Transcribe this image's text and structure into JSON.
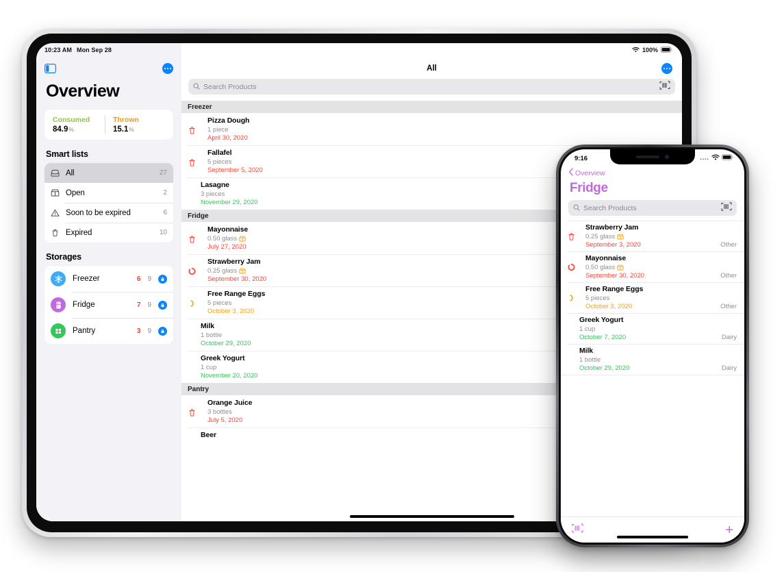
{
  "ipad": {
    "status_bar": {
      "time": "10:23 AM",
      "date": "Mon Sep 28",
      "battery_percent": "100%",
      "wifi_icon": "wifi-icon",
      "battery_icon": "battery-icon"
    },
    "sidebar": {
      "toggle_icon": "sidebar-toggle-icon",
      "more_icon": "more-ellipsis-icon",
      "title": "Overview",
      "stats": [
        {
          "label": "Consumed",
          "value": "84.9",
          "unit": "%",
          "color": "#8bc53f"
        },
        {
          "label": "Thrown",
          "value": "15.1",
          "unit": "%",
          "color": "#ff9500"
        }
      ],
      "smart_lists_header": "Smart lists",
      "smart_lists": [
        {
          "label": "All",
          "count": "27",
          "icon": "tray-icon",
          "selected": true
        },
        {
          "label": "Open",
          "count": "2",
          "icon": "open-box-icon",
          "selected": false
        },
        {
          "label": "Soon to be expired",
          "count": "6",
          "icon": "warning-triangle-icon",
          "selected": false
        },
        {
          "label": "Expired",
          "count": "10",
          "icon": "trash-icon",
          "selected": false
        }
      ],
      "storages_header": "Storages",
      "storages": [
        {
          "label": "Freezer",
          "count_red": "6",
          "count_grey": "9",
          "icon": "snowflake-icon",
          "color": "#3dabf5",
          "badge_icon": "lock-icon"
        },
        {
          "label": "Fridge",
          "count_red": "7",
          "count_grey": "9",
          "icon": "fridge-icon",
          "color": "#c06ae0",
          "badge_icon": "lock-icon"
        },
        {
          "label": "Pantry",
          "count_red": "3",
          "count_grey": "9",
          "icon": "pantry-icon",
          "color": "#34c759",
          "badge_icon": "lock-icon"
        }
      ]
    },
    "detail": {
      "title": "All",
      "more_icon": "more-ellipsis-icon",
      "search": {
        "placeholder": "Search Products",
        "search_icon": "search-icon",
        "barcode_icon": "barcode-scanner-icon"
      },
      "sections": [
        {
          "name": "Freezer",
          "items": [
            {
              "name": "Pizza Dough",
              "amount": "1 piece",
              "date": "April 30, 2020",
              "date_color": "#ff453a",
              "status_icon": "trash-icon",
              "indent": true,
              "opened": false
            },
            {
              "name": "Fallafel",
              "amount": "5 pieces",
              "date": "September 5, 2020",
              "date_color": "#ff453a",
              "status_icon": "trash-icon",
              "indent": true,
              "opened": false
            },
            {
              "name": "Lasagne",
              "amount": "3 pieces",
              "date": "November 29, 2020",
              "date_color": "#34c759",
              "status_icon": "",
              "indent": false,
              "opened": false
            }
          ]
        },
        {
          "name": "Fridge",
          "items": [
            {
              "name": "Mayonnaise",
              "amount": "0.50 glass",
              "date": "July 27, 2020",
              "date_color": "#ff453a",
              "status_icon": "trash-icon",
              "indent": true,
              "opened": true
            },
            {
              "name": "Strawberry Jam",
              "amount": "0.25 glass",
              "date": "September 30, 2020",
              "date_color": "#ff453a",
              "status_icon": "expiring-circle-icon",
              "indent": true,
              "opened": true
            },
            {
              "name": "Free Range Eggs",
              "amount": "5 pieces",
              "date": "October 3, 2020",
              "date_color": "#ff9f0a",
              "status_icon": "soon-crescent-icon",
              "indent": true,
              "opened": false
            },
            {
              "name": "Milk",
              "amount": "1 bottle",
              "date": "October 29, 2020",
              "date_color": "#34c759",
              "status_icon": "",
              "indent": false,
              "opened": false
            },
            {
              "name": "Greek Yogurt",
              "amount": "1 cup",
              "date": "November 20, 2020",
              "date_color": "#34c759",
              "status_icon": "",
              "indent": false,
              "opened": false
            }
          ]
        },
        {
          "name": "Pantry",
          "items": [
            {
              "name": "Orange Juice",
              "amount": "3 bottles",
              "date": "July 5, 2020",
              "date_color": "#ff453a",
              "status_icon": "trash-icon",
              "indent": true,
              "opened": false
            },
            {
              "name": "Beer",
              "amount": "",
              "date": "",
              "date_color": "#34c759",
              "status_icon": "",
              "indent": false,
              "opened": false
            }
          ]
        }
      ]
    }
  },
  "iphone": {
    "status_bar": {
      "time": "9:16",
      "wifi_icon": "wifi-icon",
      "battery_icon": "battery-icon",
      "signal_icon": "signal-dots-icon"
    },
    "back_label": "Overview",
    "back_icon": "chevron-left-icon",
    "title": "Fridge",
    "search": {
      "placeholder": "Search Products",
      "search_icon": "search-icon",
      "barcode_icon": "barcode-scanner-icon"
    },
    "items": [
      {
        "name": "Strawberry Jam",
        "amount": "0.25 glass",
        "date": "September 3, 2020",
        "date_color": "#ff453a",
        "category": "Other",
        "status_icon": "trash-icon",
        "indent": true,
        "opened": true
      },
      {
        "name": "Mayonnaise",
        "amount": "0.50 glass",
        "date": "September 30, 2020",
        "date_color": "#ff453a",
        "category": "Other",
        "status_icon": "expiring-circle-icon",
        "indent": true,
        "opened": true
      },
      {
        "name": "Free Range Eggs",
        "amount": "5 pieces",
        "date": "October 3, 2020",
        "date_color": "#ff9f0a",
        "category": "Other",
        "status_icon": "soon-crescent-icon",
        "indent": true,
        "opened": false
      },
      {
        "name": "Greek Yogurt",
        "amount": "1 cup",
        "date": "October 7, 2020",
        "date_color": "#34c759",
        "category": "Dairy",
        "status_icon": "",
        "indent": false,
        "opened": false
      },
      {
        "name": "Milk",
        "amount": "1 bottle",
        "date": "October 29, 2020",
        "date_color": "#34c759",
        "category": "Dairy",
        "status_icon": "",
        "indent": false,
        "opened": false
      }
    ],
    "toolbar": {
      "barcode_icon": "barcode-scanner-icon",
      "add_label": "+",
      "accent": "#c06ae0"
    }
  }
}
